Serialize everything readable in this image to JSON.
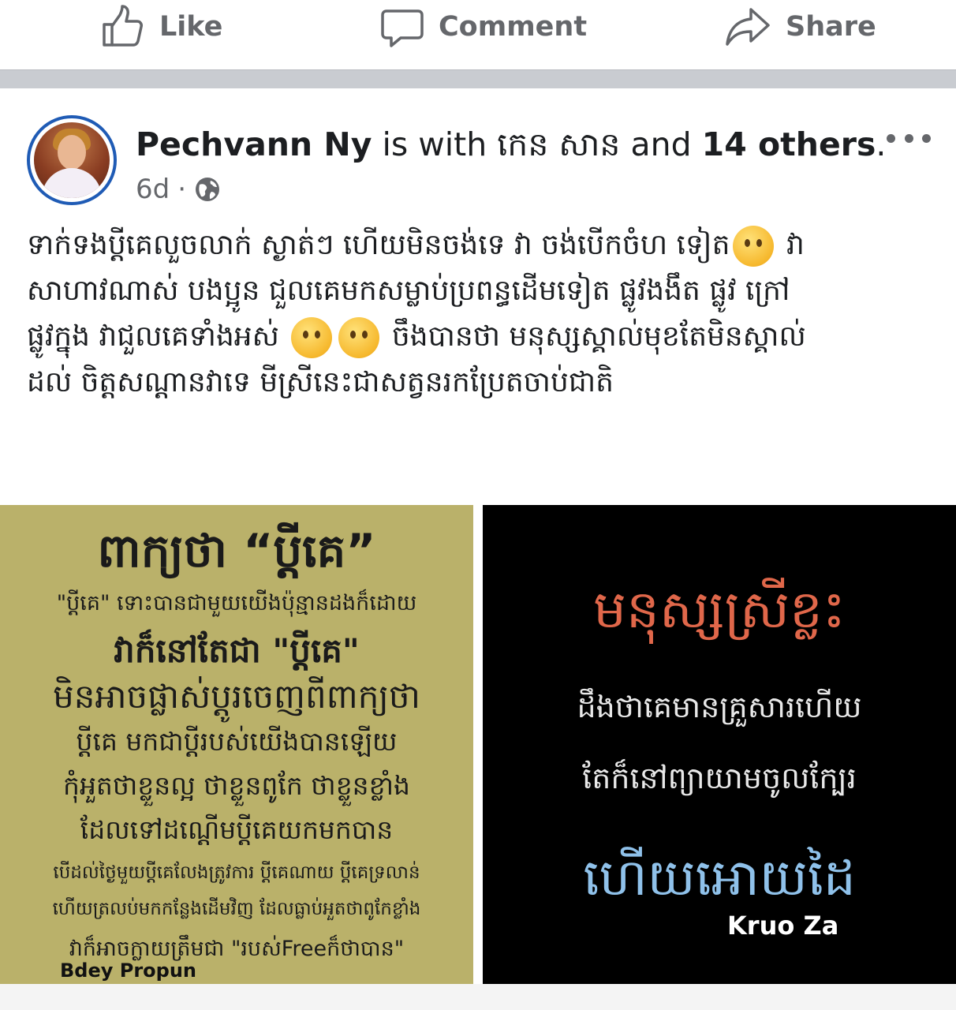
{
  "actions": {
    "like": "Like",
    "comment": "Comment",
    "share": "Share"
  },
  "post": {
    "author": "Pechvann Ny",
    "with_text": " is with ",
    "tagged_name": "កេន សាន",
    "and_text": " and ",
    "others": "14 others",
    "period": ".",
    "time": "6d",
    "separator": "·",
    "audience_icon": "globe-icon",
    "text_lines": [
      "ទាក់ទងប្តីគេលួចលាក់ ស្ងាត់ៗ ហើយមិនចង់ទេ វា ចង់បើកចំហ ទៀត",
      "វា",
      "សាហាវណាស់ បងប្អូន ជួលគេមកសម្លាប់ប្រពន្ធដើមទៀត ផ្លូវងងឹត ផ្លូវ ក្រៅ",
      "ផ្លូវក្នុង វាជួលគេទាំងអស់",
      "ចឹងបានថា មនុស្សស្គាល់មុខតែមិនស្គាល់",
      "ដល់ ចិត្តសណ្ដានវាទេ មីស្រីនេះជាសត្វនរកប្រែតចាប់ជាតិ"
    ]
  },
  "image_left": {
    "lines": [
      "ពាក្យថា “ប្តីគេ”",
      "\"ប្តីគេ\" ទោះបានជាមួយយើងប៉ុន្មានដងក៏ដោយ",
      "វាក៏នៅតែជា \"ប្តីគេ\"",
      "មិនអាចផ្លាស់ប្តូរចេញពីពាក្យថា",
      "ប្តីគេ មកជាប្តីរបស់យើងបានឡើយ",
      "កុំអួតថាខ្លួនល្អ ថាខ្លួនពូកែ ថាខ្លួនខ្លាំង",
      "ដែលទៅដណ្តើមប្តីគេយកមកបាន",
      "បើដល់ថ្ងៃមួយប្តីគេលែងត្រូវការ ប្តីគេណាយ ប្តីគេទ្រលាន់",
      "ហើយត្រលប់មកកន្លែងដើមវិញ ដែលធ្លាប់អួតថាពូកែខ្លាំង",
      "វាក៏អាចក្លាយត្រឹមជា \"របស់Freeក៏ថាបាន\""
    ],
    "signature": "Bdey Propun"
  },
  "image_right": {
    "lines": [
      "មនុស្សស្រីខ្លះ",
      "ដឹងថាគេមានគ្រួសារហើយ",
      "តែក៏នៅព្យាយាមចូលក្បែរ",
      "ហើយអោយដៃ"
    ],
    "signature": "Kruo Za"
  },
  "colors": {
    "gray_text": "#65676b",
    "avatar_ring": "#1f5bb5",
    "left_bg": "#bab16a",
    "right_title": "#e0674a",
    "right_accent": "#8fc1ea"
  }
}
